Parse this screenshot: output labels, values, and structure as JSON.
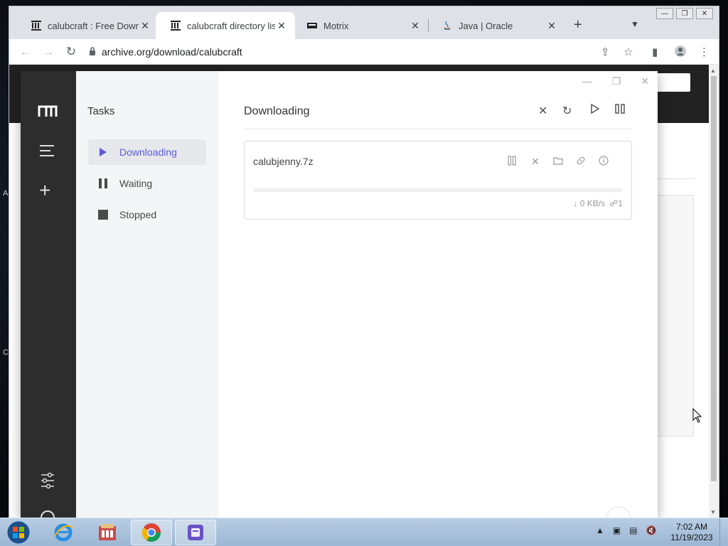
{
  "browser": {
    "tabs": [
      {
        "label": "calubcraft : Free Downlo",
        "icon": "archive-icon",
        "active": false
      },
      {
        "label": "calubcraft directory listi",
        "icon": "archive-icon",
        "active": true
      },
      {
        "label": "Motrix",
        "icon": "motrix-tab-icon",
        "active": false
      },
      {
        "label": "Java | Oracle",
        "icon": "java-icon",
        "active": false
      }
    ],
    "url": "archive.org/download/calubcraft"
  },
  "motrix": {
    "section_title": "Tasks",
    "nav": [
      {
        "label": "Downloading",
        "icon": "play-icon"
      },
      {
        "label": "Waiting",
        "icon": "pause-icon"
      },
      {
        "label": "Stopped",
        "icon": "stop-icon"
      }
    ],
    "header_title": "Downloading",
    "task": {
      "name": "calubjenny.7z",
      "progress": 0,
      "speed": "0 KB/s",
      "connections": "1"
    }
  },
  "desktop": {
    "side_letters": [
      "A",
      "C"
    ]
  },
  "taskbar": {
    "time": "7:02 AM",
    "date": "11/19/2023",
    "apps": [
      "ie-icon",
      "archive-manager-icon",
      "chrome-icon",
      "motrix-icon"
    ]
  }
}
